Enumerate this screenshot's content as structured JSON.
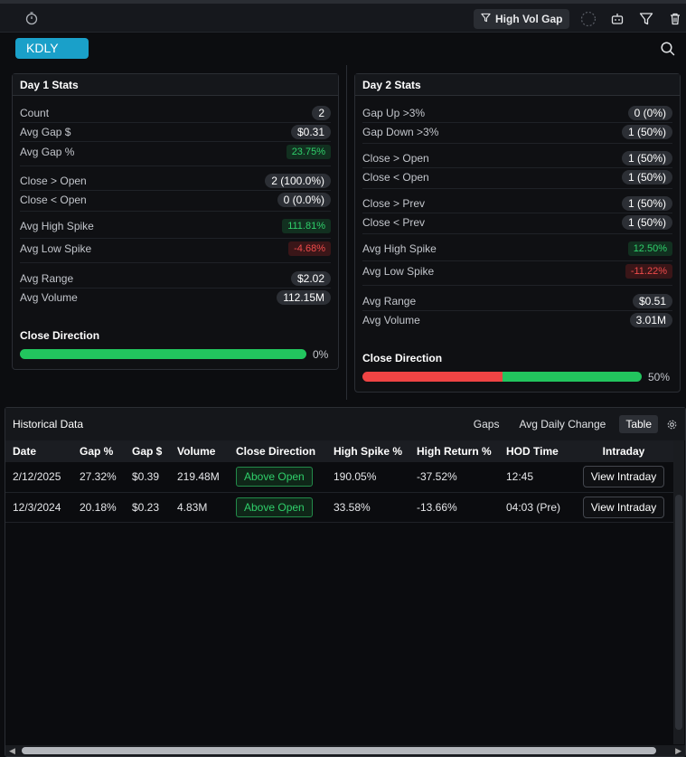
{
  "toolbar": {
    "filter_label": "High Vol Gap"
  },
  "ticker": "KDLY",
  "day1": {
    "title": "Day 1 Stats",
    "count_label": "Count",
    "count": "2",
    "avg_gap_dollar_label": "Avg Gap $",
    "avg_gap_dollar": "$0.31",
    "avg_gap_pct_label": "Avg Gap %",
    "avg_gap_pct": "23.75%",
    "close_gt_open_label": "Close > Open",
    "close_gt_open": "2 (100.0%)",
    "close_lt_open_label": "Close < Open",
    "close_lt_open": "0 (0.0%)",
    "avg_high_spike_label": "Avg High Spike",
    "avg_high_spike": "111.81%",
    "avg_low_spike_label": "Avg Low Spike",
    "avg_low_spike": "-4.68%",
    "avg_range_label": "Avg Range",
    "avg_range": "$2.02",
    "avg_volume_label": "Avg Volume",
    "avg_volume": "112.15M",
    "close_direction_label": "Close Direction",
    "close_direction_pct": "0%",
    "close_direction_red_fraction": 0.0
  },
  "day2": {
    "title": "Day 2 Stats",
    "gap_up_label": "Gap Up >3%",
    "gap_up": "0 (0%)",
    "gap_down_label": "Gap Down >3%",
    "gap_down": "1 (50%)",
    "close_gt_open_label": "Close > Open",
    "close_gt_open": "1 (50%)",
    "close_lt_open_label": "Close < Open",
    "close_lt_open": "1 (50%)",
    "close_gt_prev_label": "Close > Prev",
    "close_gt_prev": "1 (50%)",
    "close_lt_prev_label": "Close < Prev",
    "close_lt_prev": "1 (50%)",
    "avg_high_spike_label": "Avg High Spike",
    "avg_high_spike": "12.50%",
    "avg_low_spike_label": "Avg Low Spike",
    "avg_low_spike": "-11.22%",
    "avg_range_label": "Avg Range",
    "avg_range": "$0.51",
    "avg_volume_label": "Avg Volume",
    "avg_volume": "3.01M",
    "close_direction_label": "Close Direction",
    "close_direction_pct": "50%",
    "close_direction_red_fraction": 0.5
  },
  "historical": {
    "title": "Historical Data",
    "tabs": [
      "Gaps",
      "Avg Daily Change",
      "Table"
    ],
    "active_tab": "Table",
    "columns": [
      "Date",
      "Gap %",
      "Gap $",
      "Volume",
      "Close Direction",
      "High Spike %",
      "High Return %",
      "HOD Time",
      "Intraday"
    ],
    "rows": [
      {
        "date": "2/12/2025",
        "gap_pct": "27.32%",
        "gap_dollar": "$0.39",
        "volume": "219.48M",
        "close_direction": "Above Open",
        "high_spike": "190.05%",
        "high_return": "-37.52%",
        "hod_time": "12:45",
        "intraday": "View Intraday"
      },
      {
        "date": "12/3/2024",
        "gap_pct": "20.18%",
        "gap_dollar": "$0.23",
        "volume": "4.83M",
        "close_direction": "Above Open",
        "high_spike": "33.58%",
        "high_return": "-13.66%",
        "hod_time": "04:03 (Pre)",
        "intraday": "View Intraday"
      }
    ]
  },
  "colors": {
    "accent": "#1aa0c9",
    "positive": "#22c55e",
    "negative": "#ef4444"
  }
}
